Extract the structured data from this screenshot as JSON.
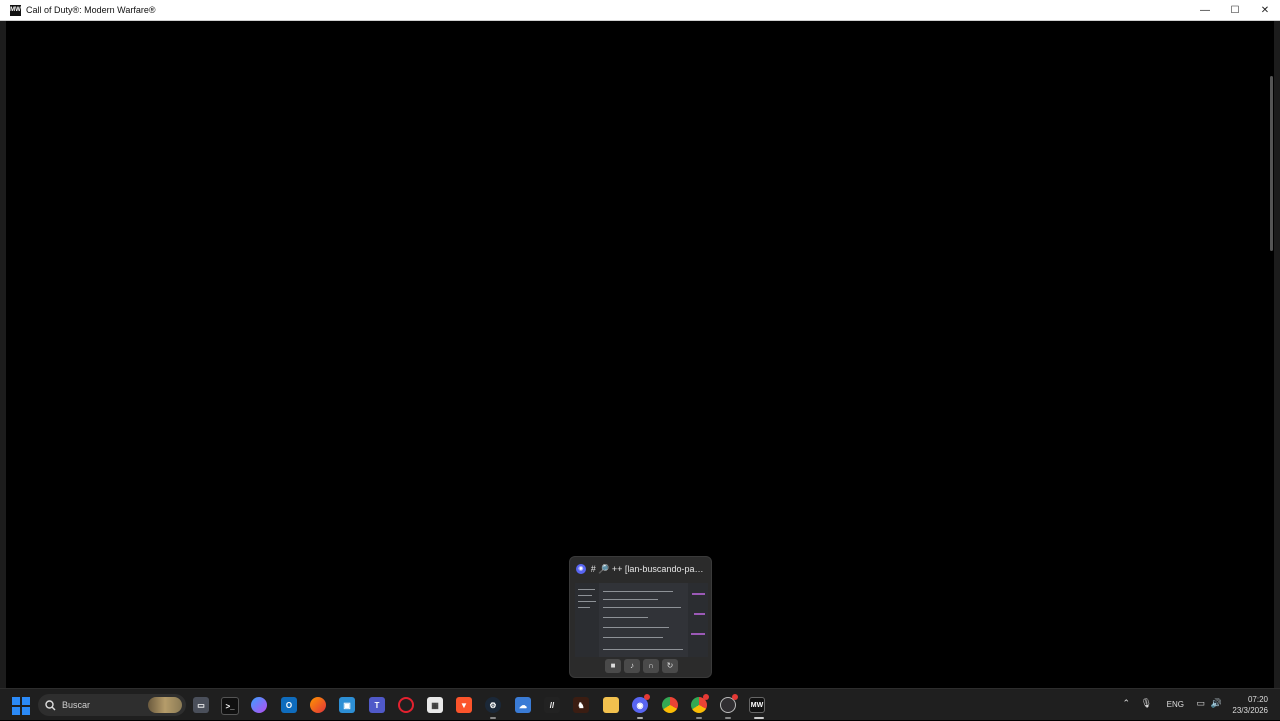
{
  "window": {
    "title": "Call of Duty®: Modern Warfare®",
    "app_icon": "MW",
    "controls": {
      "minimize": "—",
      "maximize": "☐",
      "close": "✕"
    }
  },
  "preview": {
    "title": "# 🔎 ++ [lan-buscando-part...",
    "app": "discord-icon",
    "buttons": [
      "camera-icon",
      "mic-icon",
      "headphones-icon",
      "leave-call-icon"
    ]
  },
  "taskbar": {
    "search_placeholder": "Buscar",
    "apps": [
      "task-view",
      "terminal",
      "copilot",
      "outlook",
      "firefox",
      "remote-desktop",
      "teams",
      "opera",
      "microsoft-store",
      "brave",
      "steam",
      "weather",
      "mod-tool",
      "game-launcher",
      "file-explorer",
      "discord",
      "chrome",
      "chrome-profile",
      "obs-studio",
      "modern-warfare"
    ],
    "tray": {
      "language": "ENG",
      "time": "07:20",
      "date": "23/3/2026"
    }
  }
}
